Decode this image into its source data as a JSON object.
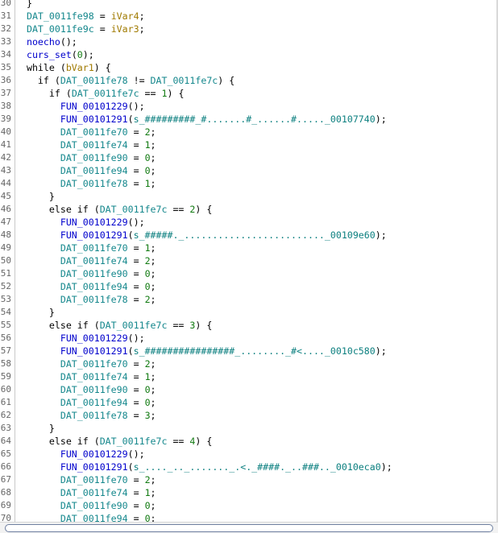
{
  "editor": {
    "first_line_number": 30,
    "lines": [
      [
        {
          "t": "  }",
          "c": "kw"
        }
      ],
      [
        {
          "t": "  DAT_0011fe98",
          "c": "dat"
        },
        {
          "t": " = ",
          "c": "kw"
        },
        {
          "t": "iVar4",
          "c": "var"
        },
        {
          "t": ";",
          "c": "kw"
        }
      ],
      [
        {
          "t": "  DAT_0011fe9c",
          "c": "dat"
        },
        {
          "t": " = ",
          "c": "kw"
        },
        {
          "t": "iVar3",
          "c": "var"
        },
        {
          "t": ";",
          "c": "kw"
        }
      ],
      [
        {
          "t": "  noecho",
          "c": "fn"
        },
        {
          "t": "();",
          "c": "kw"
        }
      ],
      [
        {
          "t": "  curs_set",
          "c": "fn"
        },
        {
          "t": "(",
          "c": "kw"
        },
        {
          "t": "0",
          "c": "num"
        },
        {
          "t": ");",
          "c": "kw"
        }
      ],
      [
        {
          "t": "  while (",
          "c": "kw"
        },
        {
          "t": "bVar1",
          "c": "var"
        },
        {
          "t": ") {",
          "c": "kw"
        }
      ],
      [
        {
          "t": "    if (",
          "c": "kw"
        },
        {
          "t": "DAT_0011fe78",
          "c": "dat"
        },
        {
          "t": " != ",
          "c": "kw"
        },
        {
          "t": "DAT_0011fe7c",
          "c": "dat"
        },
        {
          "t": ") {",
          "c": "kw"
        }
      ],
      [
        {
          "t": "      if (",
          "c": "kw"
        },
        {
          "t": "DAT_0011fe7c",
          "c": "dat"
        },
        {
          "t": " == ",
          "c": "kw"
        },
        {
          "t": "1",
          "c": "num"
        },
        {
          "t": ") {",
          "c": "kw"
        }
      ],
      [
        {
          "t": "        FUN_00101229",
          "c": "fn"
        },
        {
          "t": "();",
          "c": "kw"
        }
      ],
      [
        {
          "t": "        FUN_00101291",
          "c": "fn"
        },
        {
          "t": "(",
          "c": "kw"
        },
        {
          "t": "s_#########_#.......#_......#....._00107740",
          "c": "str"
        },
        {
          "t": ");",
          "c": "kw"
        }
      ],
      [
        {
          "t": "        DAT_0011fe70",
          "c": "dat"
        },
        {
          "t": " = ",
          "c": "kw"
        },
        {
          "t": "2",
          "c": "num"
        },
        {
          "t": ";",
          "c": "kw"
        }
      ],
      [
        {
          "t": "        DAT_0011fe74",
          "c": "dat"
        },
        {
          "t": " = ",
          "c": "kw"
        },
        {
          "t": "1",
          "c": "num"
        },
        {
          "t": ";",
          "c": "kw"
        }
      ],
      [
        {
          "t": "        DAT_0011fe90",
          "c": "dat"
        },
        {
          "t": " = ",
          "c": "kw"
        },
        {
          "t": "0",
          "c": "num"
        },
        {
          "t": ";",
          "c": "kw"
        }
      ],
      [
        {
          "t": "        DAT_0011fe94",
          "c": "dat"
        },
        {
          "t": " = ",
          "c": "kw"
        },
        {
          "t": "0",
          "c": "num"
        },
        {
          "t": ";",
          "c": "kw"
        }
      ],
      [
        {
          "t": "        DAT_0011fe78",
          "c": "dat"
        },
        {
          "t": " = ",
          "c": "kw"
        },
        {
          "t": "1",
          "c": "num"
        },
        {
          "t": ";",
          "c": "kw"
        }
      ],
      [
        {
          "t": "      }",
          "c": "kw"
        }
      ],
      [
        {
          "t": "      else if (",
          "c": "kw"
        },
        {
          "t": "DAT_0011fe7c",
          "c": "dat"
        },
        {
          "t": " == ",
          "c": "kw"
        },
        {
          "t": "2",
          "c": "num"
        },
        {
          "t": ") {",
          "c": "kw"
        }
      ],
      [
        {
          "t": "        FUN_00101229",
          "c": "fn"
        },
        {
          "t": "();",
          "c": "kw"
        }
      ],
      [
        {
          "t": "        FUN_00101291",
          "c": "fn"
        },
        {
          "t": "(",
          "c": "kw"
        },
        {
          "t": "s_#####._........................._00109e60",
          "c": "str"
        },
        {
          "t": ");",
          "c": "kw"
        }
      ],
      [
        {
          "t": "        DAT_0011fe70",
          "c": "dat"
        },
        {
          "t": " = ",
          "c": "kw"
        },
        {
          "t": "1",
          "c": "num"
        },
        {
          "t": ";",
          "c": "kw"
        }
      ],
      [
        {
          "t": "        DAT_0011fe74",
          "c": "dat"
        },
        {
          "t": " = ",
          "c": "kw"
        },
        {
          "t": "2",
          "c": "num"
        },
        {
          "t": ";",
          "c": "kw"
        }
      ],
      [
        {
          "t": "        DAT_0011fe90",
          "c": "dat"
        },
        {
          "t": " = ",
          "c": "kw"
        },
        {
          "t": "0",
          "c": "num"
        },
        {
          "t": ";",
          "c": "kw"
        }
      ],
      [
        {
          "t": "        DAT_0011fe94",
          "c": "dat"
        },
        {
          "t": " = ",
          "c": "kw"
        },
        {
          "t": "0",
          "c": "num"
        },
        {
          "t": ";",
          "c": "kw"
        }
      ],
      [
        {
          "t": "        DAT_0011fe78",
          "c": "dat"
        },
        {
          "t": " = ",
          "c": "kw"
        },
        {
          "t": "2",
          "c": "num"
        },
        {
          "t": ";",
          "c": "kw"
        }
      ],
      [
        {
          "t": "      }",
          "c": "kw"
        }
      ],
      [
        {
          "t": "      else if (",
          "c": "kw"
        },
        {
          "t": "DAT_0011fe7c",
          "c": "dat"
        },
        {
          "t": " == ",
          "c": "kw"
        },
        {
          "t": "3",
          "c": "num"
        },
        {
          "t": ") {",
          "c": "kw"
        }
      ],
      [
        {
          "t": "        FUN_00101229",
          "c": "fn"
        },
        {
          "t": "();",
          "c": "kw"
        }
      ],
      [
        {
          "t": "        FUN_00101291",
          "c": "fn"
        },
        {
          "t": "(",
          "c": "kw"
        },
        {
          "t": "s_################_........_#<...._0010c580",
          "c": "str"
        },
        {
          "t": ");",
          "c": "kw"
        }
      ],
      [
        {
          "t": "        DAT_0011fe70",
          "c": "dat"
        },
        {
          "t": " = ",
          "c": "kw"
        },
        {
          "t": "2",
          "c": "num"
        },
        {
          "t": ";",
          "c": "kw"
        }
      ],
      [
        {
          "t": "        DAT_0011fe74",
          "c": "dat"
        },
        {
          "t": " = ",
          "c": "kw"
        },
        {
          "t": "1",
          "c": "num"
        },
        {
          "t": ";",
          "c": "kw"
        }
      ],
      [
        {
          "t": "        DAT_0011fe90",
          "c": "dat"
        },
        {
          "t": " = ",
          "c": "kw"
        },
        {
          "t": "0",
          "c": "num"
        },
        {
          "t": ";",
          "c": "kw"
        }
      ],
      [
        {
          "t": "        DAT_0011fe94",
          "c": "dat"
        },
        {
          "t": " = ",
          "c": "kw"
        },
        {
          "t": "0",
          "c": "num"
        },
        {
          "t": ";",
          "c": "kw"
        }
      ],
      [
        {
          "t": "        DAT_0011fe78",
          "c": "dat"
        },
        {
          "t": " = ",
          "c": "kw"
        },
        {
          "t": "3",
          "c": "num"
        },
        {
          "t": ";",
          "c": "kw"
        }
      ],
      [
        {
          "t": "      }",
          "c": "kw"
        }
      ],
      [
        {
          "t": "      else if (",
          "c": "kw"
        },
        {
          "t": "DAT_0011fe7c",
          "c": "dat"
        },
        {
          "t": " == ",
          "c": "kw"
        },
        {
          "t": "4",
          "c": "num"
        },
        {
          "t": ") {",
          "c": "kw"
        }
      ],
      [
        {
          "t": "        FUN_00101229",
          "c": "fn"
        },
        {
          "t": "();",
          "c": "kw"
        }
      ],
      [
        {
          "t": "        FUN_00101291",
          "c": "fn"
        },
        {
          "t": "(",
          "c": "kw"
        },
        {
          "t": "s_...._.._......._.<._####._..###.._0010eca0",
          "c": "str"
        },
        {
          "t": ");",
          "c": "kw"
        }
      ],
      [
        {
          "t": "        DAT_0011fe70",
          "c": "dat"
        },
        {
          "t": " = ",
          "c": "kw"
        },
        {
          "t": "2",
          "c": "num"
        },
        {
          "t": ";",
          "c": "kw"
        }
      ],
      [
        {
          "t": "        DAT_0011fe74",
          "c": "dat"
        },
        {
          "t": " = ",
          "c": "kw"
        },
        {
          "t": "1",
          "c": "num"
        },
        {
          "t": ";",
          "c": "kw"
        }
      ],
      [
        {
          "t": "        DAT_0011fe90",
          "c": "dat"
        },
        {
          "t": " = ",
          "c": "kw"
        },
        {
          "t": "0",
          "c": "num"
        },
        {
          "t": ";",
          "c": "kw"
        }
      ],
      [
        {
          "t": "        DAT_0011fe94",
          "c": "dat"
        },
        {
          "t": " = ",
          "c": "kw"
        },
        {
          "t": "0",
          "c": "num"
        },
        {
          "t": ";",
          "c": "kw"
        }
      ]
    ]
  }
}
